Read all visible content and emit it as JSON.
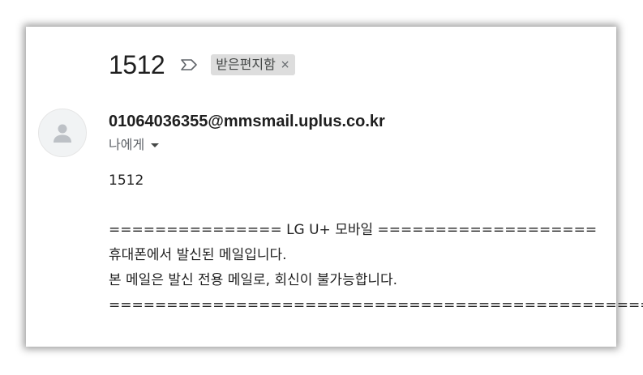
{
  "email": {
    "subject": "1512",
    "label": "받은편지함",
    "label_close": "×",
    "sender": "01064036355@mmsmail.uplus.co.kr",
    "recipient": "나에게",
    "body_lines": [
      "1512",
      "=============== LG U+ 모바일 ===================",
      "휴대폰에서 발신된 메일입니다.",
      "본 메일은 발신 전용 메일로, 회신이 불가능합니다.",
      "================================================="
    ]
  },
  "icons": {
    "important": "important-marker-icon",
    "avatar": "person-icon",
    "caret": "chevron-down-icon"
  },
  "colors": {
    "chip_bg": "#dddddd",
    "text": "#1f1f1f",
    "muted": "#5f6368"
  }
}
